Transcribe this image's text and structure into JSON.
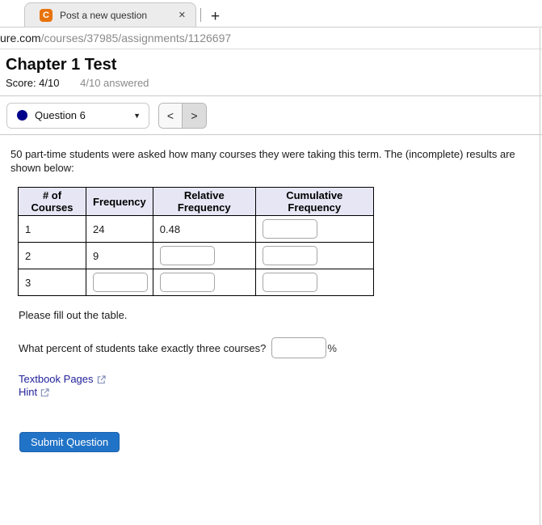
{
  "browser": {
    "tab": {
      "favicon_letter": "C",
      "title": "Post a new question",
      "close_glyph": "✕",
      "new_tab_glyph": "+"
    },
    "url": {
      "visible_host": "ure.com",
      "path": "/courses/37985/assignments/1126697"
    }
  },
  "header": {
    "title": "Chapter 1 Test",
    "score": "Score: 4/10",
    "answered": "4/10 answered"
  },
  "nav": {
    "selected_question": "Question 6",
    "dropdown_glyph": "▼",
    "prev_glyph": "<",
    "next_glyph": ">"
  },
  "question": {
    "prompt": "50 part-time students were asked how many courses they were taking this term. The (incomplete) results are shown below:",
    "table": {
      "headers": [
        "# of Courses",
        "Frequency",
        "Relative Frequency",
        "Cumulative Frequency"
      ],
      "rows": [
        {
          "courses": "1",
          "frequency": "24",
          "relative": "0.48"
        },
        {
          "courses": "2",
          "frequency": "9"
        },
        {
          "courses": "3"
        }
      ]
    },
    "fill_instruction": "Please fill out the table.",
    "percent_question": "What percent of students take exactly three courses?",
    "percent_suffix": "%",
    "links": {
      "textbook": "Textbook Pages",
      "hint": "Hint"
    },
    "submit_label": "Submit Question"
  },
  "colors": {
    "favicon_orange": "#e8720c",
    "accent_blue": "#2173c7",
    "link_navy": "#22229c",
    "table_header_bg": "#e6e6f5",
    "answered_dot_navy": "#00008b"
  }
}
